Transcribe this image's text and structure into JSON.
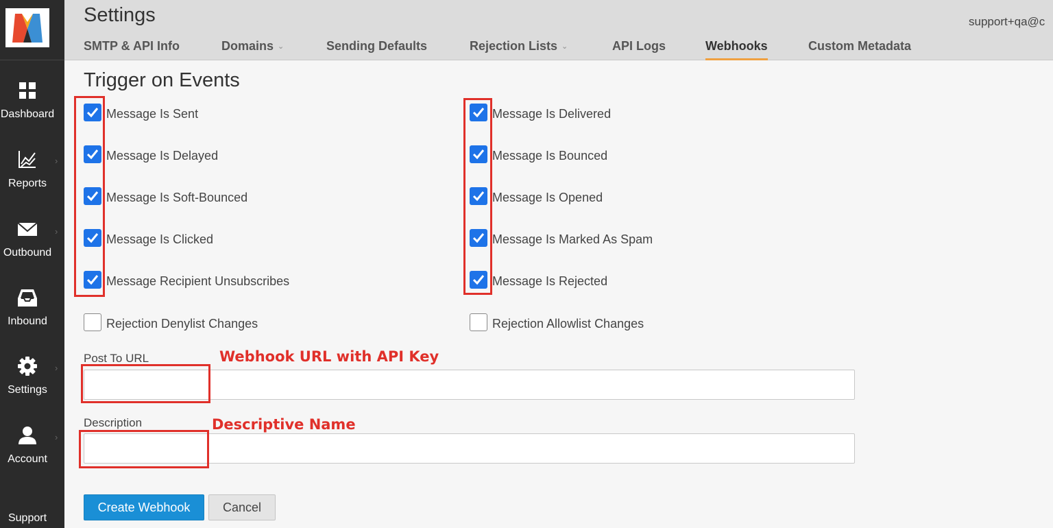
{
  "header": {
    "title": "Settings",
    "user_email": "support+qa@c",
    "tabs": [
      {
        "label": "SMTP & API Info"
      },
      {
        "label": "Domains"
      },
      {
        "label": "Sending Defaults"
      },
      {
        "label": "Rejection Lists"
      },
      {
        "label": "API Logs"
      },
      {
        "label": "Webhooks"
      },
      {
        "label": "Custom Metadata"
      }
    ],
    "active_tab": "Webhooks"
  },
  "sidebar": {
    "items": [
      {
        "label": "Dashboard",
        "icon": "grid-icon"
      },
      {
        "label": "Reports",
        "icon": "chart-icon"
      },
      {
        "label": "Outbound",
        "icon": "envelope-icon"
      },
      {
        "label": "Inbound",
        "icon": "inbox-icon"
      },
      {
        "label": "Settings",
        "icon": "gear-icon"
      },
      {
        "label": "Account",
        "icon": "user-icon"
      },
      {
        "label": "Support"
      }
    ]
  },
  "form": {
    "section_title": "Trigger on Events",
    "left_events": [
      {
        "label": "Message Is Sent",
        "checked": true
      },
      {
        "label": "Message Is Delayed",
        "checked": true
      },
      {
        "label": "Message Is Soft-Bounced",
        "checked": true
      },
      {
        "label": "Message Is Clicked",
        "checked": true
      },
      {
        "label": "Message Recipient Unsubscribes",
        "checked": true
      },
      {
        "label": "Rejection Denylist Changes",
        "checked": false
      }
    ],
    "right_events": [
      {
        "label": "Message Is Delivered",
        "checked": true
      },
      {
        "label": "Message Is Bounced",
        "checked": true
      },
      {
        "label": "Message Is Opened",
        "checked": true
      },
      {
        "label": "Message Is Marked As Spam",
        "checked": true
      },
      {
        "label": "Message Is Rejected",
        "checked": true
      },
      {
        "label": "Rejection Allowlist Changes",
        "checked": false
      }
    ],
    "post_url_label": "Post To URL",
    "post_url_value": "",
    "description_label": "Description",
    "description_value": "",
    "create_button": "Create Webhook",
    "cancel_button": "Cancel"
  },
  "annotations": {
    "url_note": "Webhook URL with API Key",
    "description_note": "Descriptive Name",
    "color": "#e0302a"
  },
  "colors": {
    "sidebar_bg": "#2b2b2b",
    "checkbox_blue": "#1e73e8",
    "primary_button": "#1a8fd6",
    "active_tab_underline": "#f0a040"
  }
}
